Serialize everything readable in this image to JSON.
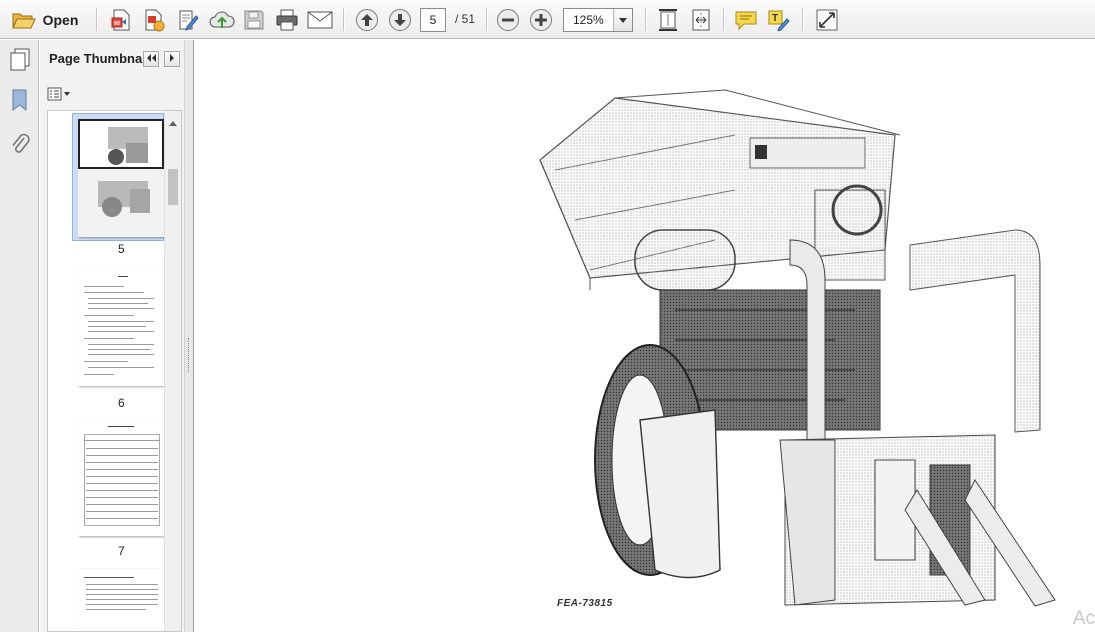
{
  "toolbar": {
    "open_label": "Open",
    "current_page": "5",
    "total_pages": "/ 51",
    "zoom": "125%"
  },
  "panel": {
    "title": "Page Thumbna..."
  },
  "thumbnails": [
    {
      "label": "5",
      "selected": true
    },
    {
      "label": "6",
      "selected": false
    },
    {
      "label": "7",
      "selected": false
    }
  ],
  "document": {
    "figure_label": "FEA-73815",
    "corner_text": "Ac"
  },
  "icons": {
    "open": "folder-open-icon",
    "create_pdf": "create-pdf-icon",
    "export_pdf": "export-pdf-icon",
    "edit_pdf": "edit-pdf-icon",
    "upload": "cloud-upload-icon",
    "save": "save-icon",
    "print": "printer-icon",
    "email": "envelope-icon",
    "prev_page": "arrow-up-icon",
    "next_page": "arrow-down-icon",
    "zoom_out": "zoom-out-icon",
    "zoom_in": "zoom-in-icon",
    "fit_page": "fit-page-icon",
    "fit_width": "fit-width-icon",
    "comment": "comment-icon",
    "highlight": "highlight-icon",
    "fullscreen": "fullscreen-icon"
  },
  "colors": {
    "selection": "#c9dcf3",
    "toolbar_bg": "#efefef"
  }
}
